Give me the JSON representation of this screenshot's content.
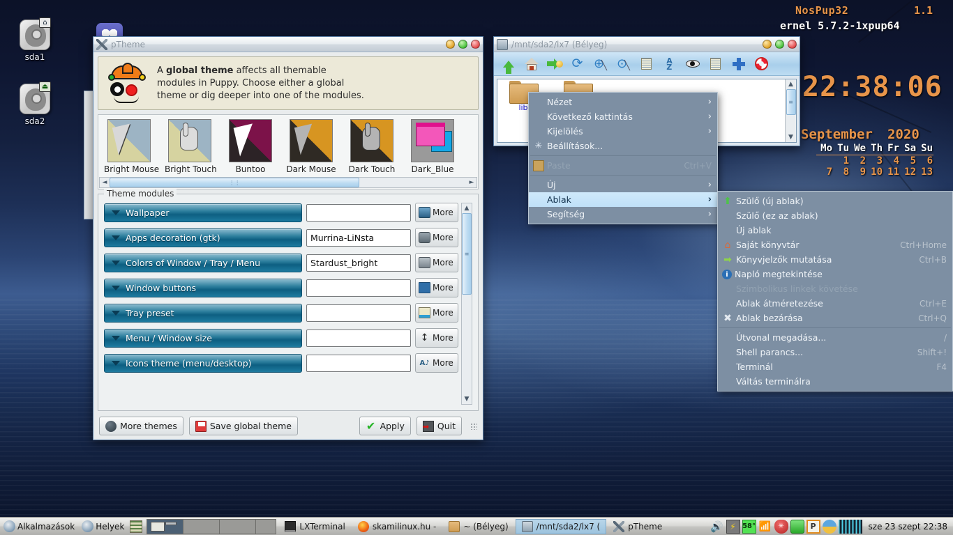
{
  "desktop": {
    "icons": [
      {
        "label": "sda1",
        "icon": "harddisk-icon",
        "badge": "home-badge"
      },
      {
        "label": "sda2",
        "icon": "harddisk-icon",
        "badge": "eject-badge"
      }
    ],
    "conky": {
      "distro_name": "NosPup32",
      "distro_version": "1.1",
      "kernel": "ernel 5.7.2-1xpup64",
      "clock": "22:38:06",
      "month": "September",
      "year": "2020",
      "weekday_headers": [
        "Mo",
        "Tu",
        "We",
        "Th",
        "Fr",
        "Sa",
        "Su"
      ],
      "weeks": [
        [
          "",
          "1",
          "2",
          "3",
          "4",
          "5",
          "6"
        ],
        [
          "7",
          "8",
          "9",
          "10",
          "11",
          "12",
          "13"
        ]
      ]
    }
  },
  "ptheme_window": {
    "title": "pTheme",
    "titlebar_icon": "tools-icon",
    "window_buttons": [
      "minimize",
      "maximize",
      "close"
    ],
    "info": {
      "icon": "jester-icon",
      "line1_pre": "A ",
      "line1_bold": "global theme",
      "line1_post": " affects all themable",
      "line2": "modules in Puppy. Choose either a global",
      "line3": "theme or dig deeper into one of the modules."
    },
    "themes": [
      {
        "label": "Bright Mouse",
        "cursor": "arrow",
        "bg_a": "#d6d3a0",
        "bg_b": "#9db4c4"
      },
      {
        "label": "Bright Touch",
        "cursor": "hand",
        "bg_a": "#d6d3a0",
        "bg_b": "#9db4c4"
      },
      {
        "label": "Buntoo",
        "cursor": "arrow",
        "bg_a": "#2c2326",
        "bg_b": "#7c1249"
      },
      {
        "label": "Dark Mouse",
        "cursor": "arrow",
        "bg_a": "#2f2a24",
        "bg_b": "#d79521"
      },
      {
        "label": "Dark Touch",
        "cursor": "hand",
        "bg_a": "#2f2a24",
        "bg_b": "#d79521"
      },
      {
        "label": "Dark_Blue",
        "cursor": "windows",
        "bg_a": "#9a9a9a",
        "bg_b": "#9a9a9a"
      }
    ],
    "modules_group_label": "Theme modules",
    "modules": [
      {
        "label": "Wallpaper",
        "value": "",
        "more_label": "More",
        "more_icon": "monitor-icon"
      },
      {
        "label": "Apps decoration (gtk)",
        "value": "Murrina-LiNsta",
        "more_label": "More",
        "more_icon": "window-decoration-icon"
      },
      {
        "label": "Colors of Window / Tray / Menu",
        "value": "Stardust_bright",
        "more_label": "More",
        "more_icon": "windows-stack-icon"
      },
      {
        "label": "Window buttons",
        "value": "",
        "more_label": "More",
        "more_icon": "titlebar-buttons-icon"
      },
      {
        "label": "Tray preset",
        "value": "",
        "more_label": "More",
        "more_icon": "tray-icon"
      },
      {
        "label": "Menu / Window size",
        "value": "",
        "more_label": "More",
        "more_icon": "resize-vertical-icon"
      },
      {
        "label": "Icons theme (menu/desktop)",
        "value": "",
        "more_label": "More",
        "more_icon": "icon-theme-icon"
      }
    ],
    "buttons": {
      "more_themes": "More themes",
      "more_themes_icon": "globe-icon",
      "save_global": "Save global theme",
      "save_global_icon": "floppy-icon",
      "apply": "Apply",
      "apply_icon": "checkmark-icon",
      "quit": "Quit",
      "quit_icon": "exit-door-icon"
    }
  },
  "filemanager_window": {
    "title": "/mnt/sda2/lx7 (Bélyeg)",
    "titlebar_icon": "filemanager-icon",
    "toolbar": [
      {
        "name": "up-icon"
      },
      {
        "name": "home-icon"
      },
      {
        "name": "bookmarks-icon"
      },
      {
        "name": "refresh-icon"
      },
      {
        "name": "zoom-in-icon"
      },
      {
        "name": "zoom-fit-icon"
      },
      {
        "name": "details-view-icon"
      },
      {
        "name": "sort-az-icon"
      },
      {
        "name": "show-hidden-icon"
      },
      {
        "name": "list-view-icon"
      },
      {
        "name": "new-icon"
      },
      {
        "name": "help-icon"
      }
    ],
    "items": [
      {
        "label": "lib",
        "icon": "folder-icon"
      },
      {
        "label": "",
        "icon": "folder-icon"
      }
    ]
  },
  "context_menu": {
    "items": [
      {
        "label": "Nézet",
        "icon": "",
        "accel": "",
        "submenu": true,
        "disabled": false,
        "selected": false
      },
      {
        "label": "Következő kattintás",
        "icon": "",
        "accel": "",
        "submenu": true,
        "disabled": false,
        "selected": false
      },
      {
        "label": "Kijelölés",
        "icon": "",
        "accel": "",
        "submenu": true,
        "disabled": false,
        "selected": false
      },
      {
        "label": "Beállítások...",
        "icon": "settings-icon",
        "accel": "",
        "submenu": false,
        "disabled": false,
        "selected": false
      },
      {
        "separator": true
      },
      {
        "label": "Paste",
        "icon": "paste-icon",
        "accel": "Ctrl+V",
        "submenu": false,
        "disabled": true,
        "selected": false
      },
      {
        "separator": true
      },
      {
        "label": "Új",
        "icon": "",
        "accel": "",
        "submenu": true,
        "disabled": false,
        "selected": false
      },
      {
        "label": "Ablak",
        "icon": "",
        "accel": "",
        "submenu": true,
        "disabled": false,
        "selected": true
      },
      {
        "label": "Segítség",
        "icon": "",
        "accel": "",
        "submenu": true,
        "disabled": false,
        "selected": false
      }
    ]
  },
  "context_submenu": {
    "items": [
      {
        "label": "Szülő (új ablak)",
        "icon": "up-arrow-icon",
        "accel": ""
      },
      {
        "label": "Szülő (ez az ablak)",
        "icon": "",
        "accel": ""
      },
      {
        "label": "Új ablak",
        "icon": "",
        "accel": ""
      },
      {
        "label": "Saját könyvtár",
        "icon": "home-icon",
        "accel": "Ctrl+Home"
      },
      {
        "label": "Könyvjelzők mutatása",
        "icon": "bookmarks-icon",
        "accel": "Ctrl+B"
      },
      {
        "label": "Napló megtekintése",
        "icon": "info-icon",
        "accel": ""
      },
      {
        "label": "Szimbolikus linkek követése",
        "icon": "",
        "accel": "",
        "disabled": true
      },
      {
        "label": "Ablak átméretezése",
        "icon": "",
        "accel": "Ctrl+E"
      },
      {
        "label": "Ablak bezárása",
        "icon": "close-x-icon",
        "accel": "Ctrl+Q"
      },
      {
        "separator": true
      },
      {
        "label": "Útvonal megadása...",
        "icon": "",
        "accel": "/"
      },
      {
        "label": "Shell parancs...",
        "icon": "",
        "accel": "Shift+!"
      },
      {
        "label": "Terminál",
        "icon": "",
        "accel": "F4"
      },
      {
        "label": "Váltás terminálra",
        "icon": "",
        "accel": ""
      }
    ]
  },
  "taskbar": {
    "menus": [
      {
        "label": "Alkalmazások",
        "icon": "puppy-icon"
      },
      {
        "label": "Helyek",
        "icon": "puppy-icon"
      }
    ],
    "show_desktop_icon": "show-desktop-icon",
    "pager_count": 4,
    "pager_active_index": 0,
    "tasks": [
      {
        "label": "LXTerminal",
        "icon": "terminal-icon",
        "active": false
      },
      {
        "label": "skamilinux.hu - ",
        "icon": "firefox-icon",
        "active": false
      },
      {
        "label": "~ (Bélyeg)",
        "icon": "folder-icon",
        "active": false
      },
      {
        "label": "/mnt/sda2/lx7 (",
        "icon": "filemanager-icon",
        "active": true
      },
      {
        "label": "pTheme",
        "icon": "tools-icon",
        "active": false
      }
    ],
    "tray": [
      {
        "name": "volume-icon"
      },
      {
        "name": "battery-icon"
      },
      {
        "name": "temperature-icon",
        "value": "58°"
      },
      {
        "name": "wifi-icon"
      },
      {
        "name": "firewall-icon"
      },
      {
        "name": "battery-charge-icon"
      },
      {
        "name": "clipboard-icon"
      },
      {
        "name": "updates-icon"
      },
      {
        "name": "cpu-graph-icon"
      }
    ],
    "clock": "sze 23 szept 22:38"
  },
  "colors": {
    "accent": "#0d5f82",
    "desktop_text": "#e8954a",
    "menu_bg": "#7d8fa3",
    "menu_sel": "#cfe9fb"
  }
}
